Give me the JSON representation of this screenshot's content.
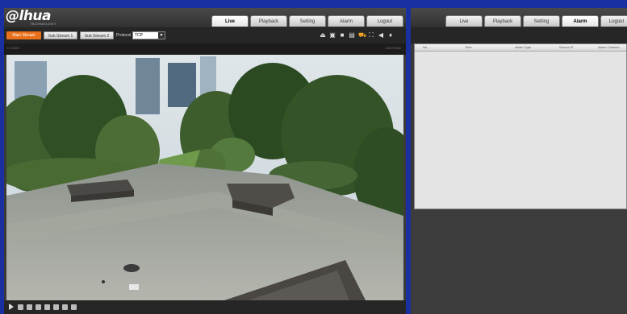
{
  "left_panel": {
    "logo": {
      "text": "@lhua",
      "sub": "TECHNOLOGY"
    },
    "nav_tabs": [
      {
        "label": "Live",
        "active": true
      },
      {
        "label": "Playback",
        "active": false
      },
      {
        "label": "Setting",
        "active": false
      },
      {
        "label": "Alarm",
        "active": false
      },
      {
        "label": "Logout",
        "active": false
      }
    ],
    "streams": {
      "main": "Main Stream",
      "sub1": "Sub Stream 1",
      "sub2": "Sub Stream 2"
    },
    "protocol": {
      "label": "Protocol",
      "value": "TCP"
    },
    "toolbar_icons": [
      "person-icon",
      "record-icon",
      "snapshot-icon",
      "image-icon",
      "camera-icon",
      "fullscreen-icon",
      "audio-icon",
      "microphone-icon"
    ],
    "info": {
      "left": "H-264/H",
      "right": "1920*1080"
    },
    "bottom_icons": [
      "play-icon",
      "zoom-icon",
      "grid-icon",
      "frame-icon",
      "layout-icon",
      "split-icon",
      "fisheye-icon",
      "window-icon"
    ]
  },
  "right_panel": {
    "nav_tabs": [
      {
        "label": "Live",
        "active": false
      },
      {
        "label": "Playback",
        "active": false
      },
      {
        "label": "Setting",
        "active": false
      },
      {
        "label": "Alarm",
        "active": true
      },
      {
        "label": "Logout",
        "active": false
      }
    ],
    "alarm_table": {
      "columns": [
        "No.",
        "Time",
        "Alarm Type",
        "Source IP",
        "Alarm Channel"
      ]
    }
  },
  "colors": {
    "accent": "#e8701a",
    "frame": "#1a2fa0"
  }
}
